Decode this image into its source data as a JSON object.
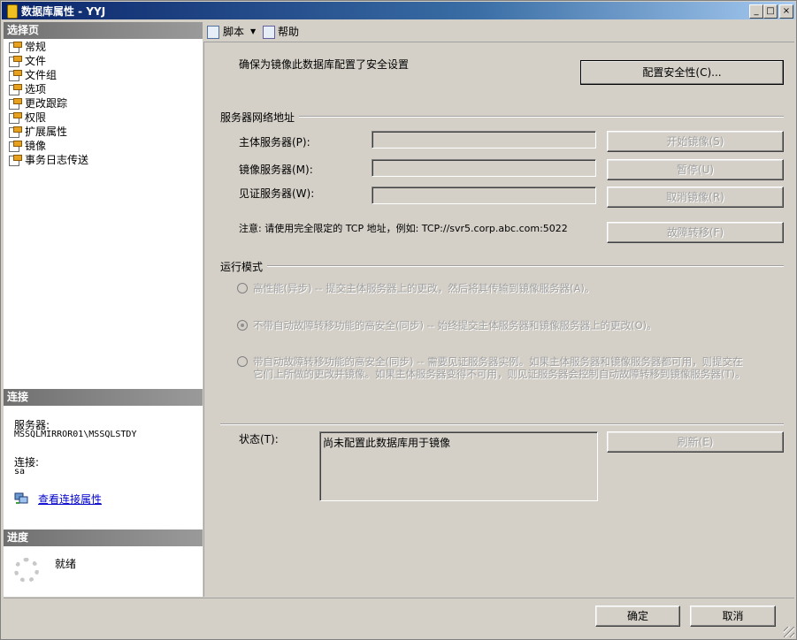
{
  "window": {
    "title": "数据库属性 - YYJ",
    "minimize": "_",
    "maximize": "□",
    "close": "×"
  },
  "sidebar": {
    "select_page_header": "选择页",
    "items": [
      {
        "label": "常规",
        "icon": "property-page-icon"
      },
      {
        "label": "文件",
        "icon": "property-page-icon"
      },
      {
        "label": "文件组",
        "icon": "property-page-icon"
      },
      {
        "label": "选项",
        "icon": "property-page-icon"
      },
      {
        "label": "更改跟踪",
        "icon": "property-page-icon"
      },
      {
        "label": "权限",
        "icon": "property-page-icon"
      },
      {
        "label": "扩展属性",
        "icon": "property-page-icon"
      },
      {
        "label": "镜像",
        "icon": "property-page-icon"
      },
      {
        "label": "事务日志传送",
        "icon": "property-page-icon"
      }
    ],
    "connection_header": "连接",
    "server_label": "服务器:",
    "server_value": "MSSQLMIRROR01\\MSSQLSTDY",
    "connection_label": "连接:",
    "connection_value": "sa",
    "view_connection_props": "查看连接属性",
    "progress_header": "进度",
    "progress_status": "就绪"
  },
  "toolbar": {
    "script_label": "脚本",
    "help_label": "帮助"
  },
  "mirroring": {
    "security_note": "确保为镜像此数据库配置了安全设置",
    "configure_security_button": "配置安全性(C)...",
    "network_group_title": "服务器网络地址",
    "principal_label": "主体服务器(P):",
    "principal_value": "",
    "mirror_label": "镜像服务器(M):",
    "mirror_value": "",
    "witness_label": "见证服务器(W):",
    "witness_value": "",
    "start_mirroring_button": "开始镜像(S)",
    "pause_button": "暂停(U)",
    "remove_mirroring_button": "取消镜像(R)",
    "failover_button": "故障转移(F)",
    "note_text": "注意: 请使用完全限定的 TCP 地址，例如: TCP://svr5.corp.abc.com:5022",
    "mode_group_title": "运行模式",
    "mode_high_perf": "高性能(异步) -- 提交主体服务器上的更改，然后将其传输到镜像服务器(A)。",
    "mode_high_safety_no_auto": "不带自动故障转移功能的高安全(同步) -- 始终提交主体服务器和镜像服务器上的更改(O)。",
    "mode_high_safety_auto_line1": "带自动故障转移功能的高安全(同步) -- 需要见证服务器实例。如果主体服务器和镜像服务器都可用，则提交在",
    "mode_high_safety_auto_line2": "它们上所做的更改并镜像。如果主体服务器变得不可用，则见证服务器会控制自动故障转移到镜像服务器(T)。",
    "status_label": "状态(T):",
    "status_value": "尚未配置此数据库用于镜像",
    "refresh_button": "刷新(E)"
  },
  "footer": {
    "ok_button": "确定",
    "cancel_button": "取消"
  }
}
